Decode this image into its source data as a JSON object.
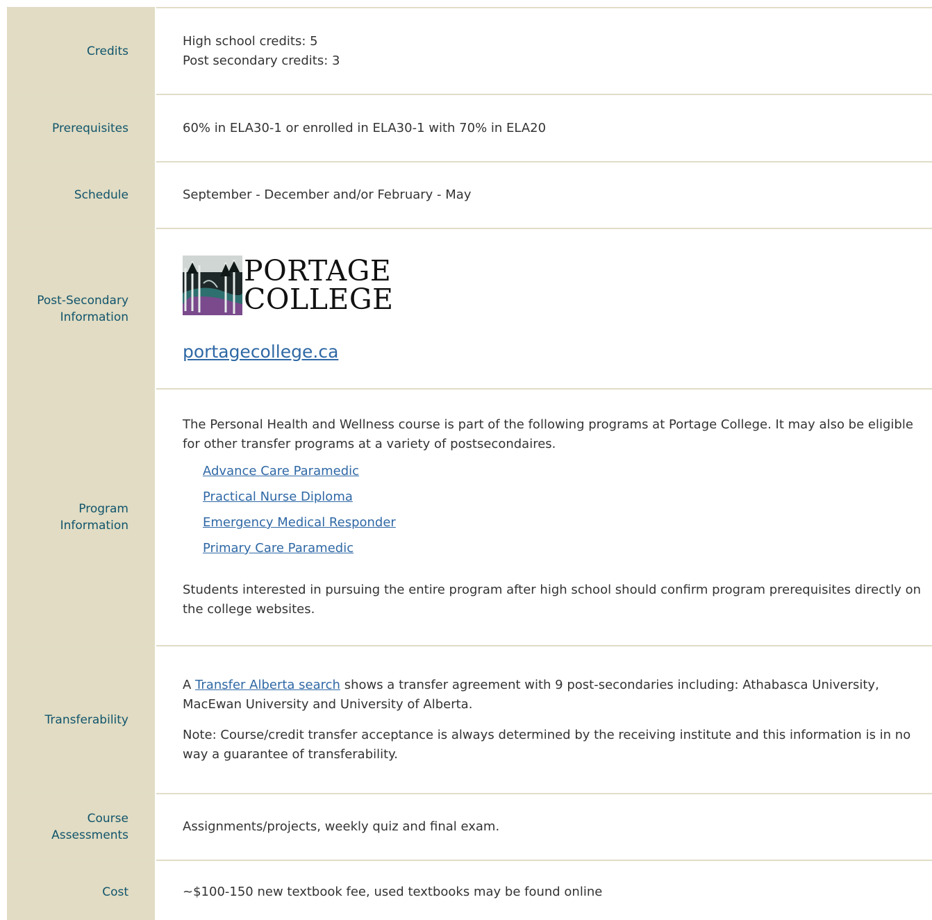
{
  "rows": {
    "credits": {
      "label": "Credits",
      "line1": "High school credits: 5",
      "line2": "Post secondary credits: 3"
    },
    "prerequisites": {
      "label": "Prerequisites",
      "value": "60% in ELA30-1 or enrolled in ELA30-1 with 70% in ELA20"
    },
    "schedule": {
      "label": "Schedule",
      "value": "September - December and/or February - May"
    },
    "post_secondary": {
      "label": "Post-Secondary Information",
      "logo_line1": "PORTAGE",
      "logo_line2": "COLLEGE",
      "link": "portagecollege.ca"
    },
    "program": {
      "label": "Program Information",
      "intro": "The Personal Health and Wellness course is part of the following programs at Portage College. It may also be eligible for other transfer programs at a variety of postsecondaires.",
      "programs": [
        "Advance Care Paramedic",
        "Practical Nurse Diploma",
        "Emergency Medical Responder",
        "Primary Care Paramedic"
      ],
      "outro": "Students interested in pursuing the entire program after high school should confirm program prerequisites directly on the college websites."
    },
    "transferability": {
      "label": "Transferability",
      "text_a": "A ",
      "link": "Transfer Alberta search",
      "text_b": " shows a transfer agreement with 9 post-secondaries including: Athabasca University, MacEwan University and University of Alberta.",
      "note": "Note: Course/credit transfer acceptance is always determined by the receiving institute and this information is in no way a guarantee of transferability."
    },
    "assessments": {
      "label": "Course Assessments",
      "value": "Assignments/projects, weekly quiz and final exam."
    },
    "cost": {
      "label": "Cost",
      "value": "~$100-150 new textbook fee, used textbooks may be found online"
    }
  },
  "colors": {
    "label_bg": "#e1dcc3",
    "label_text": "#11546c",
    "link": "#2f68a5",
    "body_text": "#333333"
  }
}
